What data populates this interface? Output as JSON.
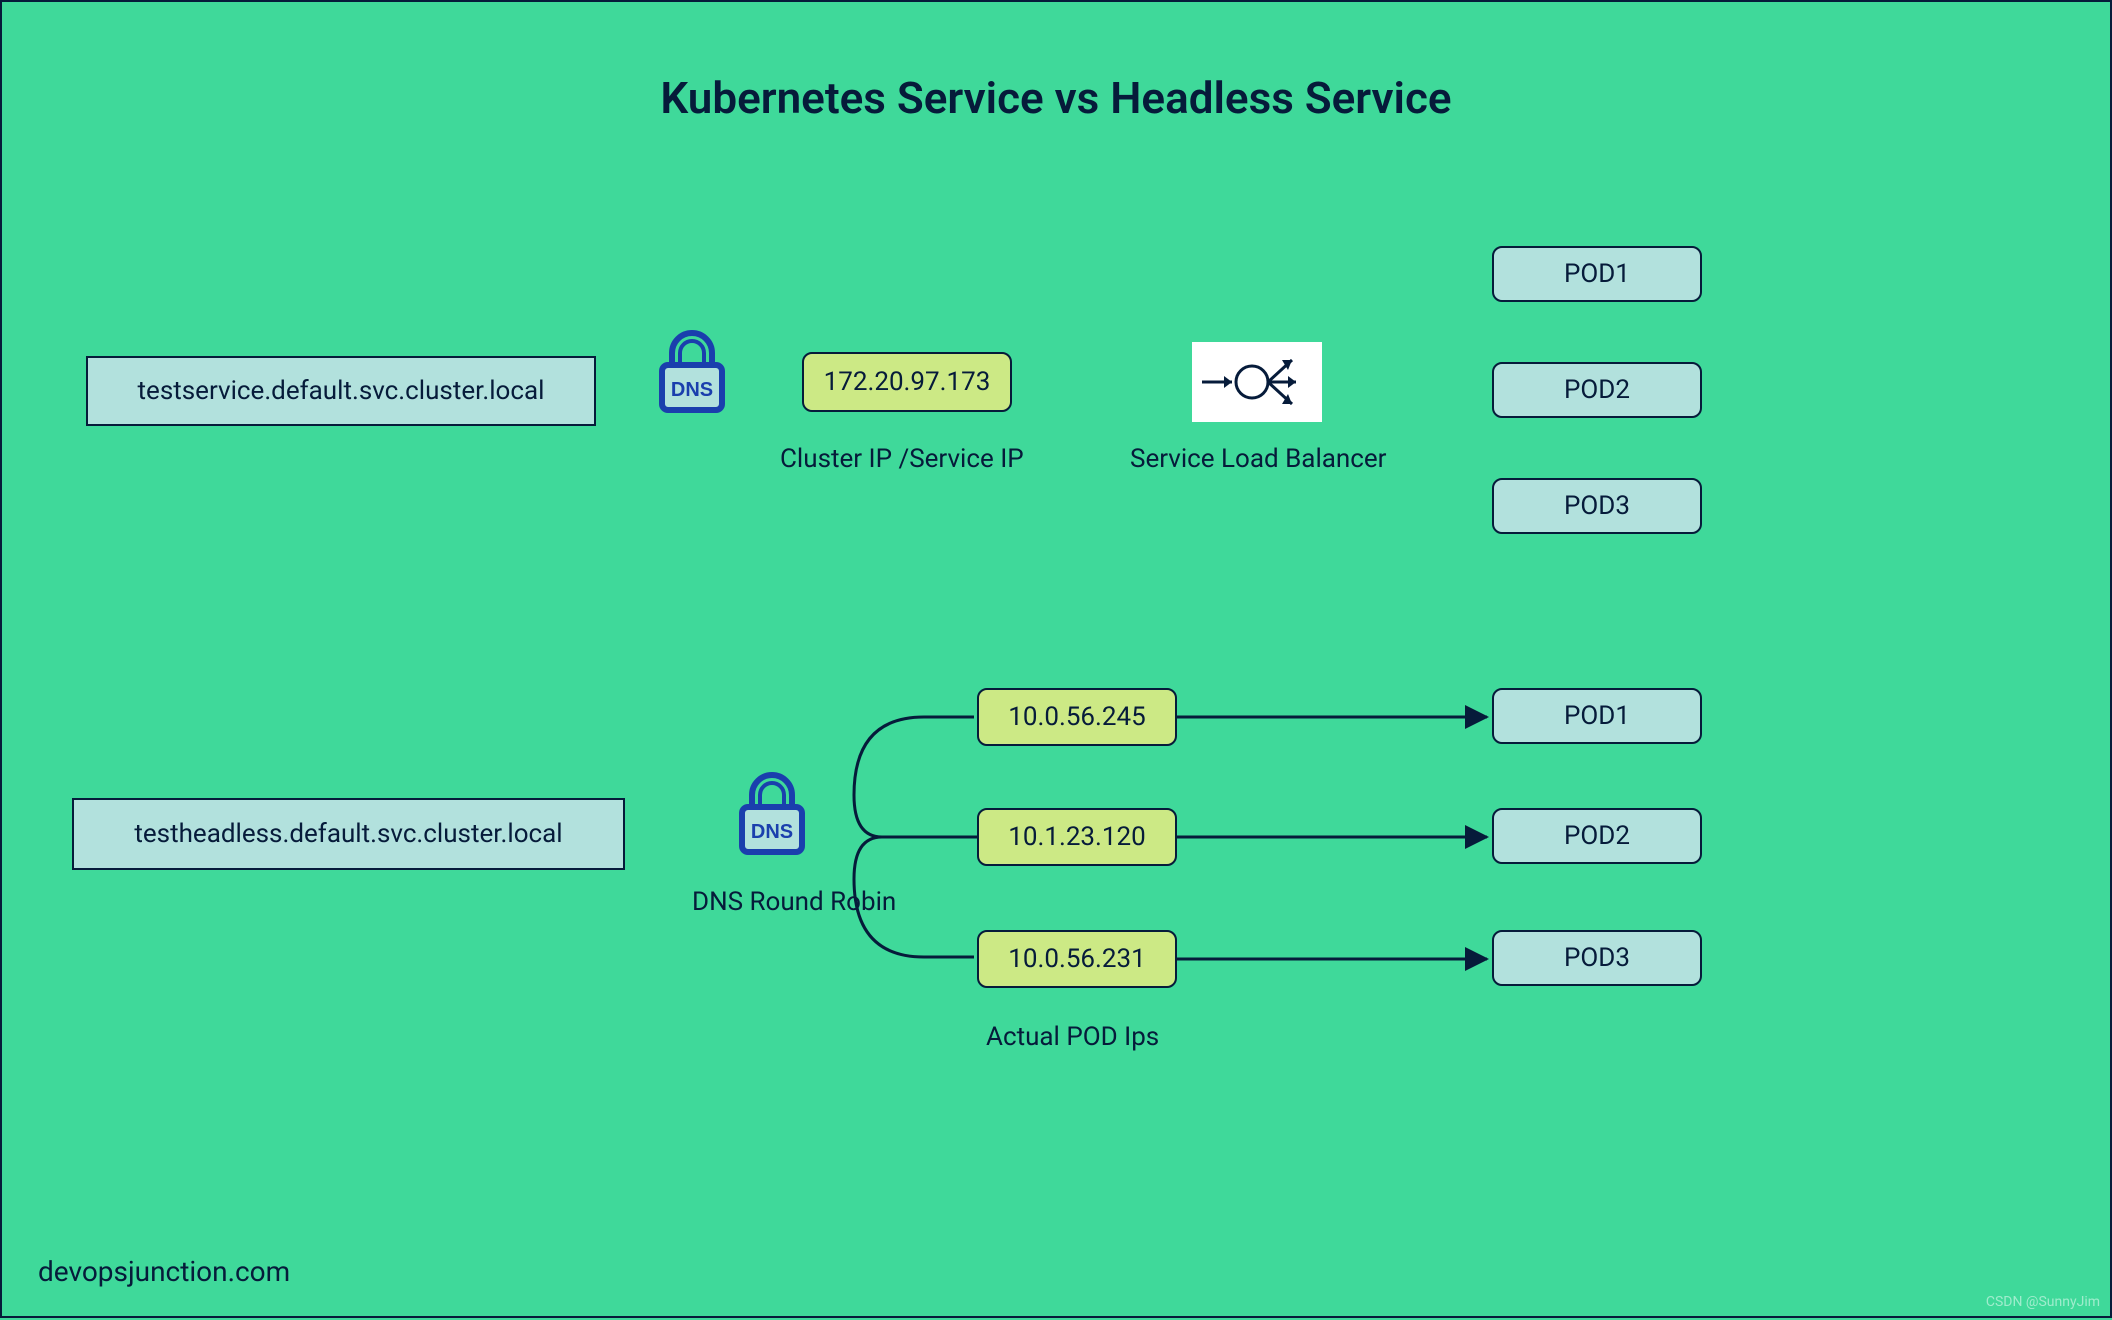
{
  "title": "Kubernetes Service vs Headless Service",
  "normal_service": {
    "dns_name": "testservice.default.svc.cluster.local",
    "cluster_ip": "172.20.97.173",
    "cluster_ip_caption": "Cluster IP /Service IP",
    "lb_caption": "Service Load Balancer",
    "pods": [
      "POD1",
      "POD2",
      "POD3"
    ]
  },
  "headless_service": {
    "dns_name": "testheadless.default.svc.cluster.local",
    "dns_caption": "DNS Round Robin",
    "ips_caption": "Actual POD Ips",
    "ips": [
      "10.0.56.245",
      "10.1.23.120",
      "10.0.56.231"
    ],
    "pods": [
      "POD1",
      "POD2",
      "POD3"
    ]
  },
  "site_credit": "devopsjunction.com",
  "watermark": "CSDN @SunnyJim",
  "colors": {
    "bg": "#3fd99a",
    "ink": "#061b3a",
    "teal_fill": "#b2e1dd",
    "lime_fill": "#cce985",
    "dns_icon": "#1a3fad"
  }
}
